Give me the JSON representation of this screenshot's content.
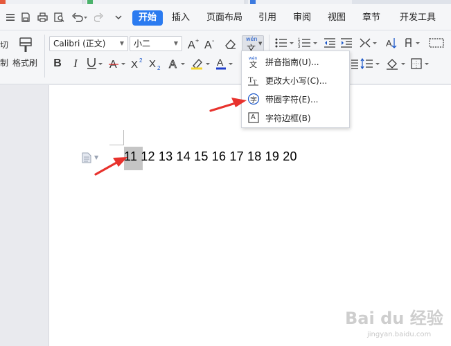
{
  "menu": {
    "tabs": [
      {
        "label": "开始",
        "active": true
      },
      {
        "label": "插入"
      },
      {
        "label": "页面布局"
      },
      {
        "label": "引用"
      },
      {
        "label": "审阅"
      },
      {
        "label": "视图"
      },
      {
        "label": "章节"
      },
      {
        "label": "开发工具"
      }
    ]
  },
  "ribbon": {
    "cut_label_partial": "切",
    "paste_label_partial": "制",
    "format_painter_label": "格式刷",
    "font_name": "Calibri (正文)",
    "font_size": "小二",
    "pinyin_icon_top": "wén",
    "pinyin_icon_bottom": "文"
  },
  "dropdown": {
    "items": [
      {
        "label": "拼音指南(U)...",
        "icon": "pinyin-guide-icon"
      },
      {
        "label": "更改大小写(C)...",
        "icon": "change-case-icon"
      },
      {
        "label": "带圈字符(E)...",
        "icon": "enclosed-character-icon",
        "icon_glyph": "字"
      },
      {
        "label": "字符边框(B)",
        "icon": "character-border-icon",
        "icon_glyph": "A"
      }
    ]
  },
  "document": {
    "text": "11 12 13 14 15 16 17 18 19 20",
    "selected_text": "11"
  },
  "watermark": {
    "logo": "Bai du 经验",
    "url": "jingyan.baidu.com"
  },
  "colors": {
    "accent": "#2b7bf0",
    "font_color_underline": "#1f3fcc",
    "highlight_color": "#f4d52b",
    "annotation_arrow": "#e8322d"
  }
}
